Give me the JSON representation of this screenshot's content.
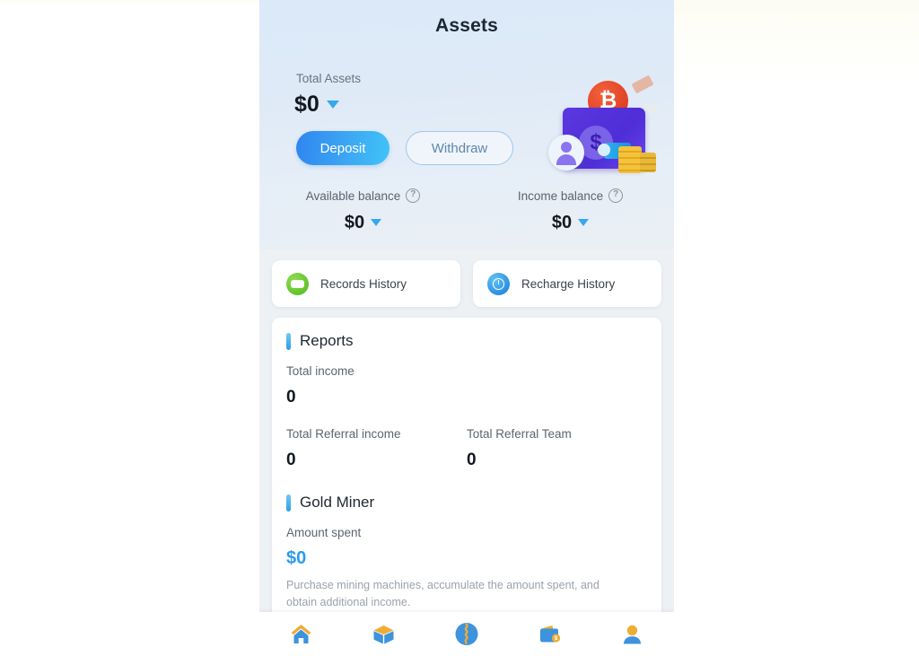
{
  "header": {
    "title": "Assets"
  },
  "hero": {
    "total_assets_label": "Total Assets",
    "total_assets_value": "$0",
    "deposit_label": "Deposit",
    "withdraw_label": "Withdraw",
    "available_balance_label": "Available balance",
    "available_balance_value": "$0",
    "income_balance_label": "Income balance",
    "income_balance_value": "$0",
    "help_glyph": "?",
    "illustration": "wallet-money-illustration"
  },
  "history": {
    "records": {
      "label": "Records History",
      "icon": "records-history-icon",
      "icon_color": "#4fb81e"
    },
    "recharge": {
      "label": "Recharge History",
      "icon": "recharge-history-icon",
      "icon_color": "#1878d6"
    }
  },
  "reports": {
    "title": "Reports",
    "total_income_label": "Total income",
    "total_income_value": "0",
    "total_referral_income_label": "Total Referral income",
    "total_referral_income_value": "0",
    "total_referral_team_label": "Total Referral Team",
    "total_referral_team_value": "0"
  },
  "gold_miner": {
    "title": "Gold Miner",
    "amount_spent_label": "Amount spent",
    "amount_spent_value": "$0",
    "description": "Purchase mining machines, accumulate the amount spent, and obtain additional income.",
    "accent_color": "#2e9bea"
  },
  "tabbar": {
    "items": [
      {
        "name": "home",
        "icon": "home-icon"
      },
      {
        "name": "products",
        "icon": "box-icon"
      },
      {
        "name": "globe",
        "icon": "globe-icon"
      },
      {
        "name": "wallet",
        "icon": "wallet-icon"
      },
      {
        "name": "profile",
        "icon": "person-icon"
      }
    ]
  },
  "theme": {
    "primary_blue": "#2f86f0",
    "light_blue": "#41c3f7",
    "accent_orange": "#eeac33",
    "nav_blue": "#3d8fd6"
  }
}
